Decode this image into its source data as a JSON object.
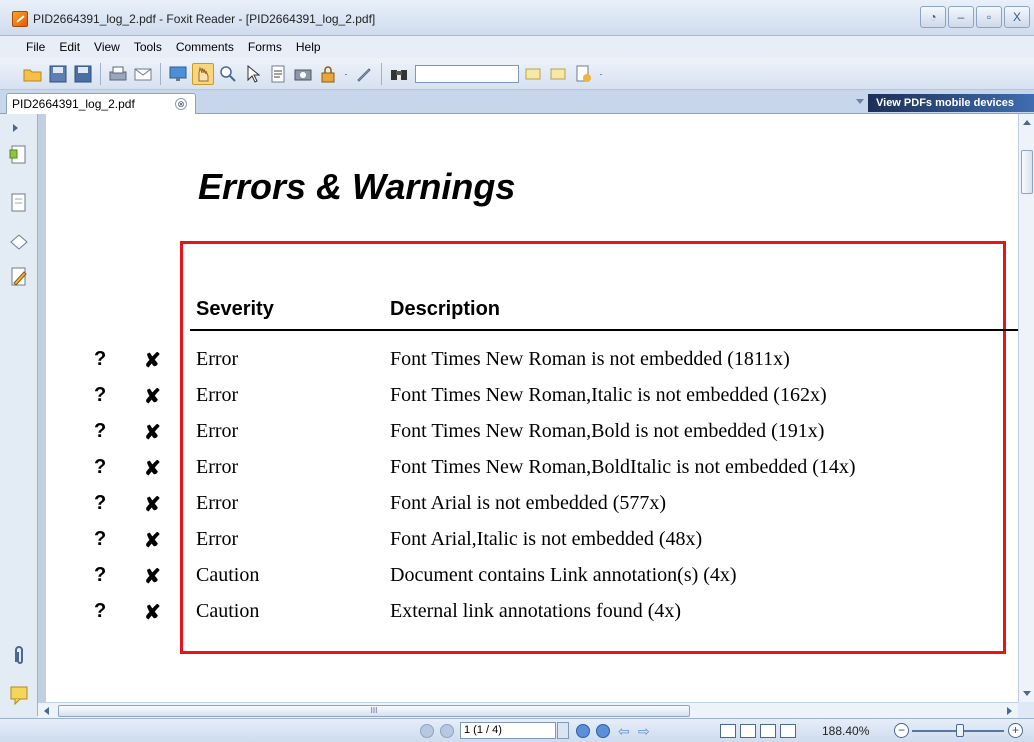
{
  "window": {
    "title": "PID2664391_log_2.pdf - Foxit Reader - [PID2664391_log_2.pdf]",
    "buttons": [
      "◔",
      "–",
      "▫",
      "X"
    ]
  },
  "menu": [
    "File",
    "Edit",
    "View",
    "Tools",
    "Comments",
    "Forms",
    "Help"
  ],
  "tab": {
    "label": "PID2664391_log_2.pdf",
    "close": "⊗"
  },
  "banner": "View PDFs mobile devices",
  "document": {
    "title": "Errors & Warnings",
    "columns": {
      "severity": "Severity",
      "description": "Description"
    },
    "rows": [
      {
        "q": "?",
        "x": "✘",
        "severity": "Error",
        "description": "Font Times New Roman is not embedded (1811x)"
      },
      {
        "q": "?",
        "x": "✘",
        "severity": "Error",
        "description": "Font Times New Roman,Italic is not embedded (162x)"
      },
      {
        "q": "?",
        "x": "✘",
        "severity": "Error",
        "description": "Font Times New Roman,Bold is not embedded (191x)"
      },
      {
        "q": "?",
        "x": "✘",
        "severity": "Error",
        "description": "Font Times New Roman,BoldItalic is not embedded (14x)"
      },
      {
        "q": "?",
        "x": "✘",
        "severity": "Error",
        "description": "Font Arial is not embedded (577x)"
      },
      {
        "q": "?",
        "x": "✘",
        "severity": "Error",
        "description": "Font Arial,Italic is not embedded (48x)"
      },
      {
        "q": "?",
        "x": "✘",
        "severity": "Caution",
        "description": "Document contains Link annotation(s) (4x)"
      },
      {
        "q": "?",
        "x": "✘",
        "severity": "Caution",
        "description": "External link annotations found (4x)"
      }
    ]
  },
  "status": {
    "page": "1 (1 / 4)",
    "zoom": "188.40%",
    "zoom_out": "−",
    "zoom_in": "+",
    "hscroll_grip": "III"
  },
  "colors": {
    "highlight_box": "#e8141a"
  }
}
